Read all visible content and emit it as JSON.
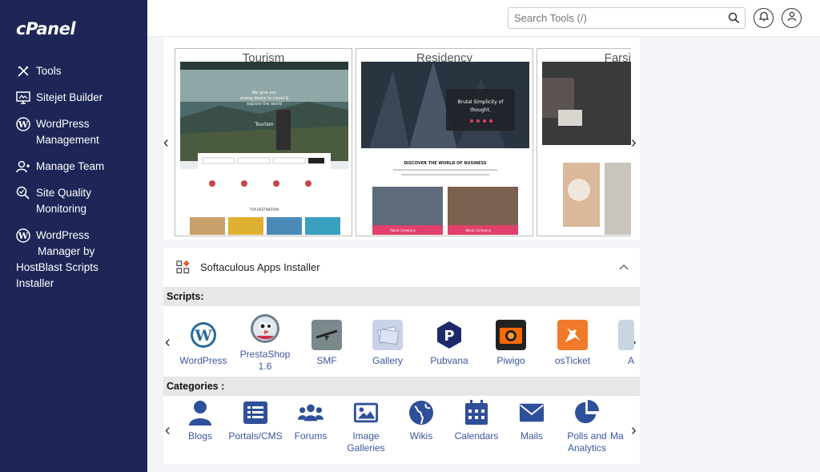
{
  "app": {
    "logo": "cPanel"
  },
  "sidebar": {
    "items": [
      {
        "label": "Tools",
        "icon": "tools-icon"
      },
      {
        "label": "Sitejet Builder",
        "icon": "monitor-icon"
      },
      {
        "label_line1": "WordPress",
        "label_line2": "Management",
        "icon": "wordpress-icon"
      },
      {
        "label": "Manage Team",
        "icon": "team-icon"
      },
      {
        "label_line1": "Site Quality",
        "label_line2": "Monitoring",
        "icon": "magnifier-icon"
      },
      {
        "label_line1": "WordPress",
        "label_line2": "Manager by",
        "label_line3": "HostBlast Scripts",
        "label_line4": "Installer",
        "icon": "wordpress-icon"
      }
    ]
  },
  "header": {
    "search_placeholder": "Search Tools (/)"
  },
  "themes": {
    "cards": [
      {
        "title": "Tourism",
        "hero_line1": "We give you",
        "hero_line2": "strong desire to travel &",
        "hero_line3": "explore the world",
        "hero_word": "Tourism",
        "section": "TOP DESTINATION"
      },
      {
        "title": "Residency",
        "hero_line1": "Brutal Simplicity of",
        "hero_line2": "thought.",
        "section": "DISCOVER THE WORLD OF BUSINESS",
        "btn1": "About Company",
        "btn2": "About Company"
      },
      {
        "title": "Farsi"
      }
    ]
  },
  "softaculous": {
    "title": "Softaculous Apps Installer",
    "scripts_label": "Scripts:",
    "categories_label": "Categories :",
    "scripts": [
      {
        "name": "WordPress",
        "icon": "wordpress-logo-icon"
      },
      {
        "name_line1": "PrestaShop",
        "name_line2": "1.6",
        "icon": "prestashop-logo-icon"
      },
      {
        "name": "SMF",
        "icon": "smf-logo-icon"
      },
      {
        "name": "Gallery",
        "icon": "gallery-logo-icon"
      },
      {
        "name": "Pubvana",
        "icon": "pubvana-logo-icon"
      },
      {
        "name": "Piwigo",
        "icon": "piwigo-logo-icon"
      },
      {
        "name": "osTicket",
        "icon": "osticket-logo-icon"
      },
      {
        "name": "A",
        "icon": "partial-app-icon"
      }
    ],
    "categories": [
      {
        "name": "Blogs",
        "icon": "user-icon"
      },
      {
        "name": "Portals/CMS",
        "icon": "list-icon"
      },
      {
        "name": "Forums",
        "icon": "users-icon"
      },
      {
        "name_line1": "Image",
        "name_line2": "Galleries",
        "icon": "image-icon"
      },
      {
        "name": "Wikis",
        "icon": "globe-icon"
      },
      {
        "name": "Calendars",
        "icon": "calendar-icon"
      },
      {
        "name": "Mails",
        "icon": "envelope-icon"
      },
      {
        "name_line1": "Polls and",
        "name_line2": "Analytics",
        "icon": "pie-chart-icon"
      },
      {
        "name": "Ma",
        "icon": "partial-category-icon"
      }
    ]
  },
  "colors": {
    "sidebar": "#1d2656",
    "link": "#3a57a0",
    "icon_blue": "#2e4f9a"
  }
}
